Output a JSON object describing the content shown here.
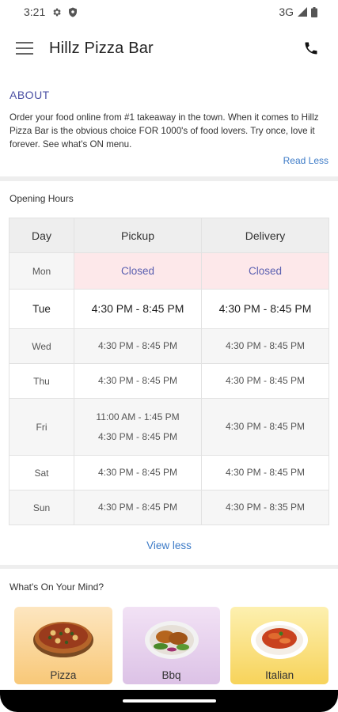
{
  "status_bar": {
    "time": "3:21",
    "network": "3G"
  },
  "app_bar": {
    "title": "Hillz Pizza Bar",
    "menu_icon": "hamburger-menu-icon",
    "call_icon": "phone-icon"
  },
  "about": {
    "heading": "ABOUT",
    "text": "Order your food online from #1 takeaway in the town. When it comes to Hillz Pizza Bar is the obvious choice FOR 1000's of food lovers. Try once, love it forever. See what's ON menu.",
    "toggle_label": "Read Less"
  },
  "opening_hours": {
    "title": "Opening Hours",
    "columns": [
      "Day",
      "Pickup",
      "Delivery"
    ],
    "rows": [
      {
        "day": "Mon",
        "pickup": [
          "Closed"
        ],
        "delivery": [
          "Closed"
        ],
        "closed": true
      },
      {
        "day": "Tue",
        "pickup": [
          "4:30 PM - 8:45 PM"
        ],
        "delivery": [
          "4:30 PM - 8:45 PM"
        ],
        "today": true
      },
      {
        "day": "Wed",
        "pickup": [
          "4:30 PM - 8:45 PM"
        ],
        "delivery": [
          "4:30 PM - 8:45 PM"
        ]
      },
      {
        "day": "Thu",
        "pickup": [
          "4:30 PM - 8:45 PM"
        ],
        "delivery": [
          "4:30 PM - 8:45 PM"
        ]
      },
      {
        "day": "Fri",
        "pickup": [
          "11:00 AM - 1:45 PM",
          "4:30 PM - 8:45 PM"
        ],
        "delivery": [
          "4:30 PM - 8:45 PM"
        ]
      },
      {
        "day": "Sat",
        "pickup": [
          "4:30 PM - 8:45 PM"
        ],
        "delivery": [
          "4:30 PM - 8:45 PM"
        ]
      },
      {
        "day": "Sun",
        "pickup": [
          "4:30 PM - 8:45 PM"
        ],
        "delivery": [
          "4:30 PM - 8:35 PM"
        ]
      }
    ],
    "toggle_label": "View less"
  },
  "whats_on_your_mind": {
    "title": "What's On Your Mind?",
    "categories": [
      {
        "label": "Pizza",
        "icon": "pizza-icon"
      },
      {
        "label": "Bbq",
        "icon": "bbq-plate-icon"
      },
      {
        "label": "Italian",
        "icon": "pasta-plate-icon"
      }
    ]
  },
  "colors": {
    "accent_link": "#3d7bc7",
    "about_heading": "#4a4fa3",
    "closed_bg": "#fde8ea",
    "closed_text": "#5a5fb0"
  }
}
